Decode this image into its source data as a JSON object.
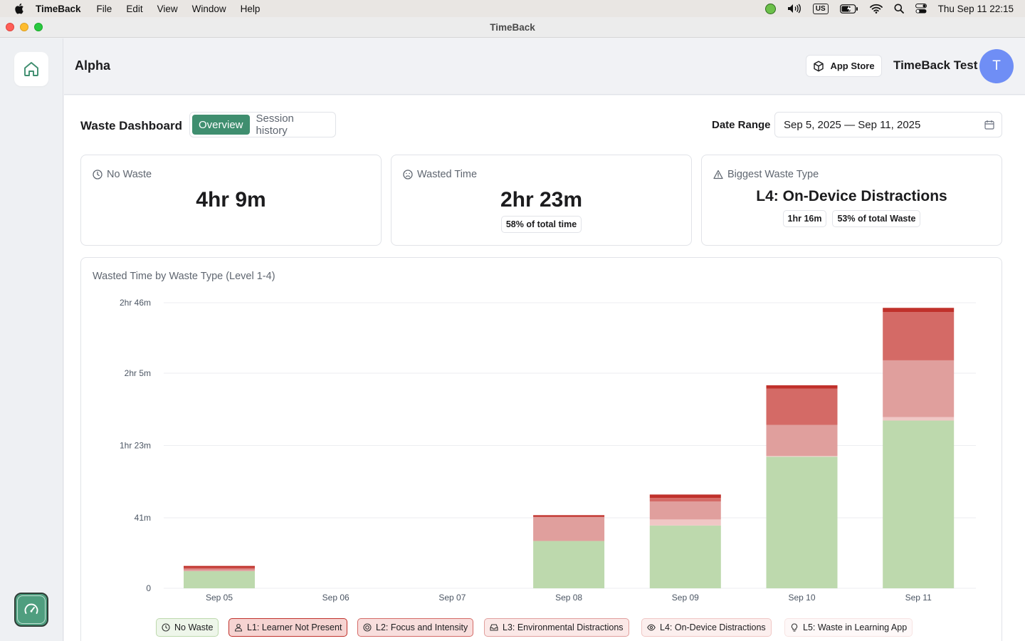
{
  "menubar": {
    "app": "TimeBack",
    "items": [
      "File",
      "Edit",
      "View",
      "Window",
      "Help"
    ],
    "clock": "Thu Sep 11  22:15",
    "keyboard": "US"
  },
  "window": {
    "title": "TimeBack"
  },
  "header": {
    "org": "Alpha",
    "app_store_label": "App Store",
    "user_name": "TimeBack Test",
    "avatar_initial": "T"
  },
  "dashboard": {
    "title": "Waste Dashboard",
    "tabs": [
      {
        "label": "Overview",
        "active": true
      },
      {
        "label": "Session history",
        "active": false
      }
    ],
    "date_range_label": "Date Range",
    "date_range_value": "Sep 5, 2025 — Sep 11, 2025"
  },
  "cards": {
    "no_waste": {
      "label": "No Waste",
      "value": "4hr 9m"
    },
    "wasted_time": {
      "label": "Wasted Time",
      "value": "2hr 23m",
      "pill": "58% of total time"
    },
    "biggest_waste": {
      "label": "Biggest Waste Type",
      "value": "L4: On-Device Distractions",
      "pill_time": "1hr 16m",
      "pill_share": "53% of total Waste"
    }
  },
  "colors": {
    "accent": "#3f8e6f",
    "no_waste": "#bdd9ad",
    "l1": "#c0312b",
    "l2": "#d46a66",
    "l3": "#e09f9d",
    "l4": "#f0c7c5",
    "l5": "#f7e4e3"
  },
  "chart_data": {
    "type": "bar",
    "stacked": true,
    "title": "Wasted Time by Waste Type (Level 1-4)",
    "categories": [
      "Sep 05",
      "Sep 06",
      "Sep 07",
      "Sep 08",
      "Sep 09",
      "Sep 10",
      "Sep 11"
    ],
    "y_unit": "minutes",
    "ylim": [
      0,
      166
    ],
    "y_ticks": [
      0,
      41,
      83,
      125,
      166
    ],
    "y_tick_labels": [
      "0",
      "41m",
      "1hr 23m",
      "2hr 5m",
      "2hr 46m"
    ],
    "series": [
      {
        "name": "No Waste",
        "color": "#bdd9ad",
        "values": [
          10,
          0,
          0,
          27.5,
          36.5,
          76.5,
          97.5
        ]
      },
      {
        "name": "L4: On-Device Distractions",
        "color": "#f0c7c5",
        "values": [
          0,
          0,
          0,
          0,
          3.5,
          0.5,
          2
        ]
      },
      {
        "name": "L3: Environmental Distractions",
        "color": "#e09f9d",
        "values": [
          1,
          0,
          0,
          14,
          10.5,
          18,
          33
        ]
      },
      {
        "name": "L2: Focus and Intensity",
        "color": "#d46a66",
        "values": [
          1,
          0,
          0,
          0,
          2,
          21,
          28
        ]
      },
      {
        "name": "L1: Learner Not Present",
        "color": "#c0312b",
        "values": [
          1,
          0,
          0,
          1,
          2,
          2,
          2.5
        ]
      }
    ],
    "legend": [
      {
        "label": "No Waste",
        "icon": "clock-icon",
        "bg": "#eef6ea",
        "border": "#bdd9ad"
      },
      {
        "label": "L1: Learner Not Present",
        "icon": "person-icon",
        "bg": "#f6d4d2",
        "border": "#c0312b"
      },
      {
        "label": "L2: Focus and Intensity",
        "icon": "target-icon",
        "bg": "#f8dedd",
        "border": "#d46a66"
      },
      {
        "label": "L3: Environmental Distractions",
        "icon": "inbox-icon",
        "bg": "#fbe8e7",
        "border": "#e09f9d"
      },
      {
        "label": "L4: On-Device Distractions",
        "icon": "eye-icon",
        "bg": "#fcefee",
        "border": "#f0c7c5"
      },
      {
        "label": "L5: Waste in Learning App",
        "icon": "bulb-icon",
        "bg": "#fef8f8",
        "border": "#f7e4e3"
      }
    ],
    "grid": true,
    "legend_position": "bottom"
  }
}
